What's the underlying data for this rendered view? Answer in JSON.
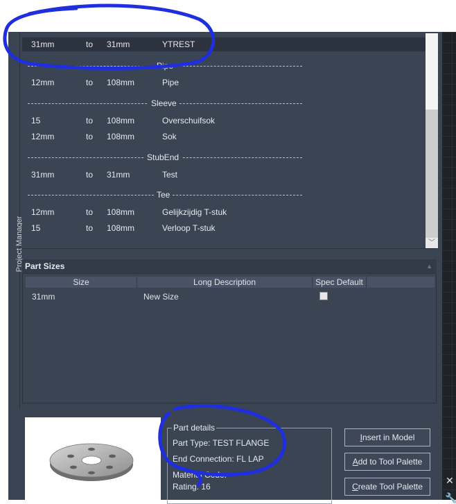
{
  "side_label": "Project Manager",
  "list": {
    "selected_row": {
      "from": "31mm",
      "to": "to",
      "until": "31mm",
      "name": "YTREST"
    },
    "groups": [
      {
        "title": "Pipe",
        "rows": [
          {
            "from": "12mm",
            "to": "to",
            "until": "108mm",
            "name": "Pipe"
          }
        ]
      },
      {
        "title": "Sleeve",
        "rows": [
          {
            "from": "15",
            "to": "to",
            "until": "108mm",
            "name": "Overschuifsok"
          },
          {
            "from": "12mm",
            "to": "to",
            "until": "108mm",
            "name": "Sok"
          }
        ]
      },
      {
        "title": "StubEnd",
        "rows": [
          {
            "from": "31mm",
            "to": "to",
            "until": "31mm",
            "name": "Test"
          }
        ]
      },
      {
        "title": "Tee",
        "rows": [
          {
            "from": "12mm",
            "to": "to",
            "until": "108mm",
            "name": "Gelijkzijdig T-stuk"
          },
          {
            "from": "15",
            "to": "to",
            "until": "108mm",
            "name": "Verloop T-stuk"
          }
        ]
      }
    ]
  },
  "part_sizes": {
    "title": "Part Sizes",
    "columns": [
      "Size",
      "Long Description",
      "Spec Default"
    ],
    "rows": [
      {
        "size": "31mm",
        "description": "New Size",
        "spec_default": false
      }
    ]
  },
  "part_details": {
    "legend": "Part details",
    "part_type": "Part Type: TEST FLANGE",
    "end_connection": "End Connection: FL LAP",
    "material_code": "Material Code:",
    "rating": "Rating: 16"
  },
  "buttons": {
    "insert": {
      "underlined": "I",
      "rest": "nsert in Model"
    },
    "add": {
      "underlined": "A",
      "rest": "dd to Tool Palette"
    },
    "create": {
      "underlined": "C",
      "rest": "reate Tool Palette"
    }
  },
  "icons": {
    "close": "close-icon",
    "wrench": "wrench-icon",
    "scroll_down": "chevron-down-icon",
    "collapse": "triangle-up-icon"
  },
  "colors": {
    "panel": "#3b4453",
    "annotation_ink": "#1f2fe0"
  }
}
